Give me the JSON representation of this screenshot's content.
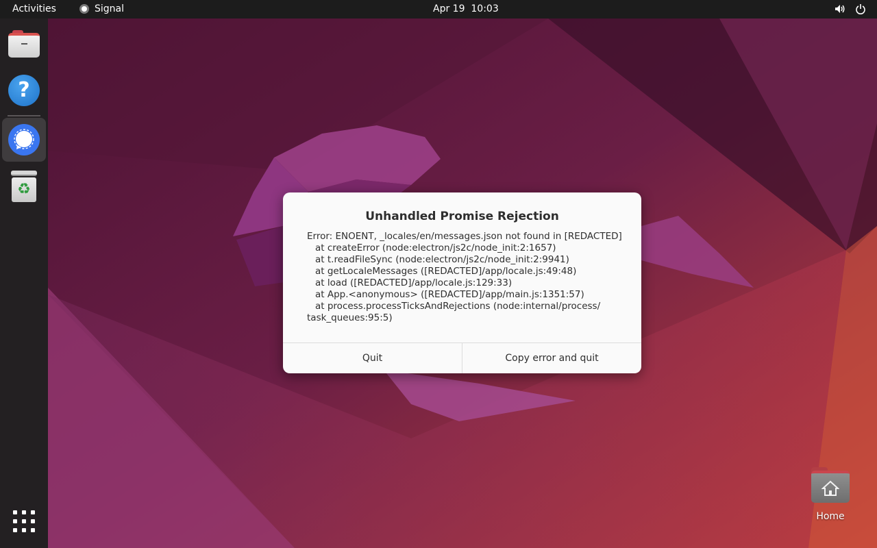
{
  "topbar": {
    "activities_label": "Activities",
    "app_name": "Signal",
    "clock": "Apr 19  10:03",
    "tray_icons": [
      "volume-icon",
      "power-icon"
    ]
  },
  "dock": {
    "items": [
      {
        "name": "files",
        "icon": "files-icon"
      },
      {
        "name": "help",
        "icon": "help-icon"
      },
      {
        "name": "signal",
        "icon": "signal-icon",
        "running": true
      },
      {
        "name": "trash",
        "icon": "trash-icon"
      }
    ],
    "apps_icon": "apps-grid-icon",
    "accent_color": "#e95420"
  },
  "desktop": {
    "home_label": "Home"
  },
  "dialog": {
    "title": "Unhandled Promise Rejection",
    "lines": [
      "Error: ENOENT, _locales/en/messages.json not found in [REDACTED]",
      "at createError (node:electron/js2c/node_init:2:1657)",
      "at t.readFileSync (node:electron/js2c/node_init:2:9941)",
      "at getLocaleMessages ([REDACTED]/app/locale.js:49:48)",
      "at load ([REDACTED]/app/locale.js:129:33)",
      "at App.<anonymous> ([REDACTED]/app/main.js:1351:57)",
      "at process.processTicksAndRejections (node:internal/process/",
      "task_queues:95:5)"
    ],
    "quit_label": "Quit",
    "copy_quit_label": "Copy error and quit"
  }
}
